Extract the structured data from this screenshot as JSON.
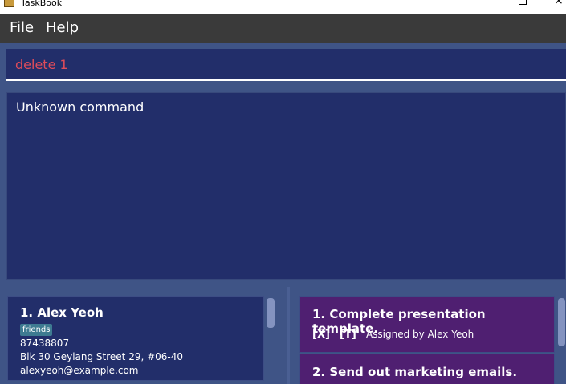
{
  "window": {
    "title": "TaskBook"
  },
  "menu": {
    "file": "File",
    "help": "Help"
  },
  "command": {
    "value": "delete 1"
  },
  "result": {
    "message": "Unknown command"
  },
  "persons": [
    {
      "index_name": "1.  Alex Yeoh",
      "tags": [
        "friends"
      ],
      "phone": "87438807",
      "address": "Blk 30 Geylang Street 29, #06-40",
      "email": "alexyeoh@example.com"
    }
  ],
  "tasks": [
    {
      "index_title": "1.  Complete presentation template.",
      "done_flag": "[X]",
      "type_flag": "[T]",
      "assigned": "Assigned by  Alex Yeoh"
    },
    {
      "index_title": "2.  Send out marketing emails."
    }
  ],
  "colors": {
    "background": "#3f5486",
    "panel": "#222e6a",
    "task_card": "#4f1f71",
    "command_text": "#e04c5a",
    "tag": "#3e7b91",
    "menubar": "#3a3a3a"
  }
}
